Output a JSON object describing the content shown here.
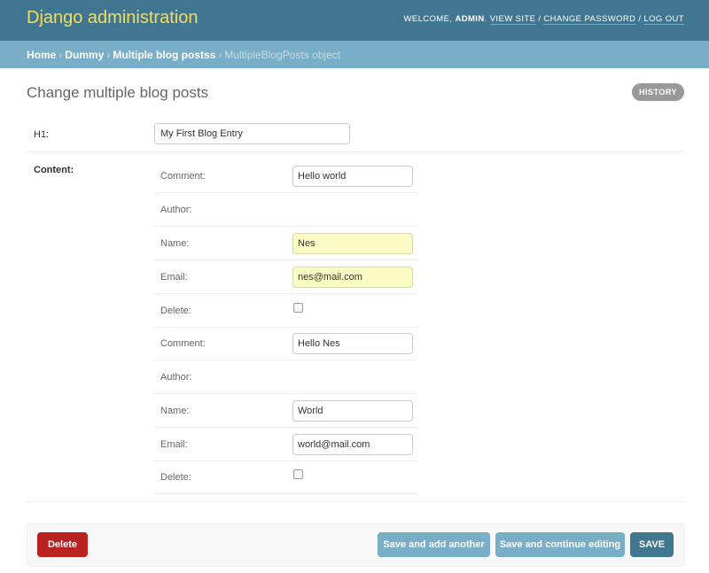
{
  "header": {
    "branding": "Django administration",
    "welcome": "Welcome,",
    "username": "admin",
    "view_site": "View site",
    "change_password": "Change password",
    "log_out": "Log out",
    "sep": "/",
    "colors": {
      "bar": "#417690",
      "branding": "#f5dd5d"
    }
  },
  "breadcrumbs": {
    "home": "Home",
    "app": "Dummy",
    "model": "Multiple blog postss",
    "current": "MultipleBlogPosts object",
    "arrow": "›"
  },
  "page": {
    "title": "Change multiple blog posts",
    "history": "History"
  },
  "form": {
    "h1_label": "H1:",
    "h1_value": "My First Blog Entry",
    "content_label": "Content:",
    "entries": [
      {
        "comment_label": "Comment:",
        "comment_value": "Hello world",
        "author_label": "Author:",
        "name_label": "Name:",
        "name_value": "Nes",
        "email_label": "Email:",
        "email_value": "nes@mail.com",
        "delete_label": "Delete:"
      },
      {
        "comment_label": "Comment:",
        "comment_value": "Hello Nes",
        "author_label": "Author:",
        "name_label": "Name:",
        "name_value": "World",
        "email_label": "Email:",
        "email_value": "world@mail.com",
        "delete_label": "Delete:"
      }
    ]
  },
  "actions": {
    "delete": "Delete",
    "save_add_another": "Save and add another",
    "save_continue": "Save and continue editing",
    "save": "SAVE",
    "colors": {
      "delete": "#ba2121",
      "secondary": "#79aec8",
      "primary": "#417690"
    }
  }
}
